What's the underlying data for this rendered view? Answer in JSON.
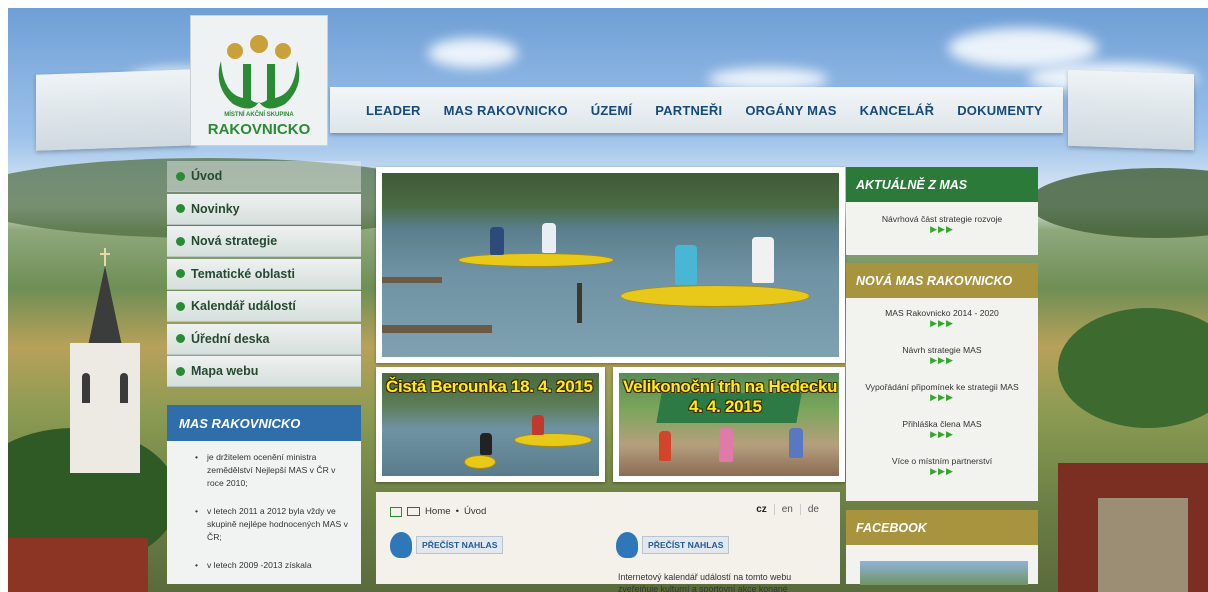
{
  "nav": {
    "items": [
      "LEADER",
      "MAS RAKOVNICKO",
      "ÚZEMÍ",
      "PARTNEŘI",
      "ORGÁNY MAS",
      "KANCELÁŘ",
      "DOKUMENTY"
    ]
  },
  "logo": {
    "line1": "MÍSTNÍ AKČNÍ SKUPINA",
    "line2": "RAKOVNICKO"
  },
  "sidebar_menu": {
    "items": [
      "Úvod",
      "Novinky",
      "Nová strategie",
      "Tematické oblasti",
      "Kalendář událostí",
      "Úřední deska",
      "Mapa webu"
    ]
  },
  "mas_box": {
    "title": "MAS RAKOVNICKO",
    "bullets": [
      "je držitelem ocenění ministra zemědělství Nejlepší MAS v ČR v roce 2010;",
      "v letech 2011 a 2012 byla vždy ve skupině nejlépe hodnocených MAS v ČR;",
      "v letech 2009 -2013 získala"
    ]
  },
  "photos": {
    "caption_left": "Čistá Berounka 18. 4. 2015",
    "caption_right_1": "Velikonoční trh na Hedecku",
    "caption_right_2": "4. 4. 2015"
  },
  "content": {
    "breadcrumb_home": "Home",
    "breadcrumb_sep": "•",
    "breadcrumb_current": "Úvod",
    "langs": [
      "cz",
      "en",
      "de"
    ],
    "read_label": "PŘEČÍST NAHLAS",
    "text": "Internetový kalendář událostí na tomto webu zveřejňuje kulturní a sportovní akce konané"
  },
  "aktualne": {
    "title": "AKTUÁLNĚ Z MAS",
    "entries": [
      "Návrhová část strategie rozvoje"
    ],
    "arrows": "▶▶▶"
  },
  "nova_mas": {
    "title": "NOVÁ MAS RAKOVNICKO",
    "entries": [
      "MAS Rakovnicko 2014 - 2020",
      "Návrh strategie MAS",
      "Vypořádání připomínek ke strategii MAS",
      "Přihláška člena MAS",
      "Více o místním partnerství"
    ],
    "arrows": "▶▶▶"
  },
  "facebook": {
    "title": "FACEBOOK"
  },
  "colors": {
    "nav_text": "#18497c",
    "menu_dot": "#2b8a34",
    "mas_head": "#2f6eab",
    "aktualne_head": "#2b7a3a",
    "nova_head": "#a8933f",
    "facebook_head": "#a8933f"
  }
}
